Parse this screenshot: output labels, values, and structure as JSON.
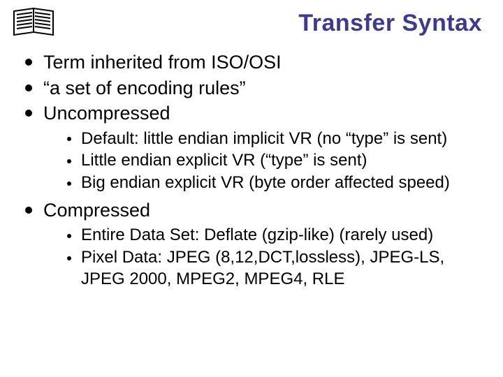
{
  "title": "Transfer Syntax",
  "bullets": {
    "b0": "Term inherited from ISO/OSI",
    "b1": "“a set of encoding rules”",
    "b2": "Uncompressed",
    "b2_sub": {
      "s0": "Default: little endian implicit VR (no “type” is sent)",
      "s1": "Little endian explicit VR (“type” is sent)",
      "s2": "Big endian explicit VR (byte order affected speed)"
    },
    "b3": "Compressed",
    "b3_sub": {
      "s0": "Entire Data Set: Deflate (gzip-like) (rarely used)",
      "s1": "Pixel Data: JPEG (8,12,DCT,lossless), JPEG-LS, JPEG 2000, MPEG2, MPEG4, RLE"
    }
  }
}
